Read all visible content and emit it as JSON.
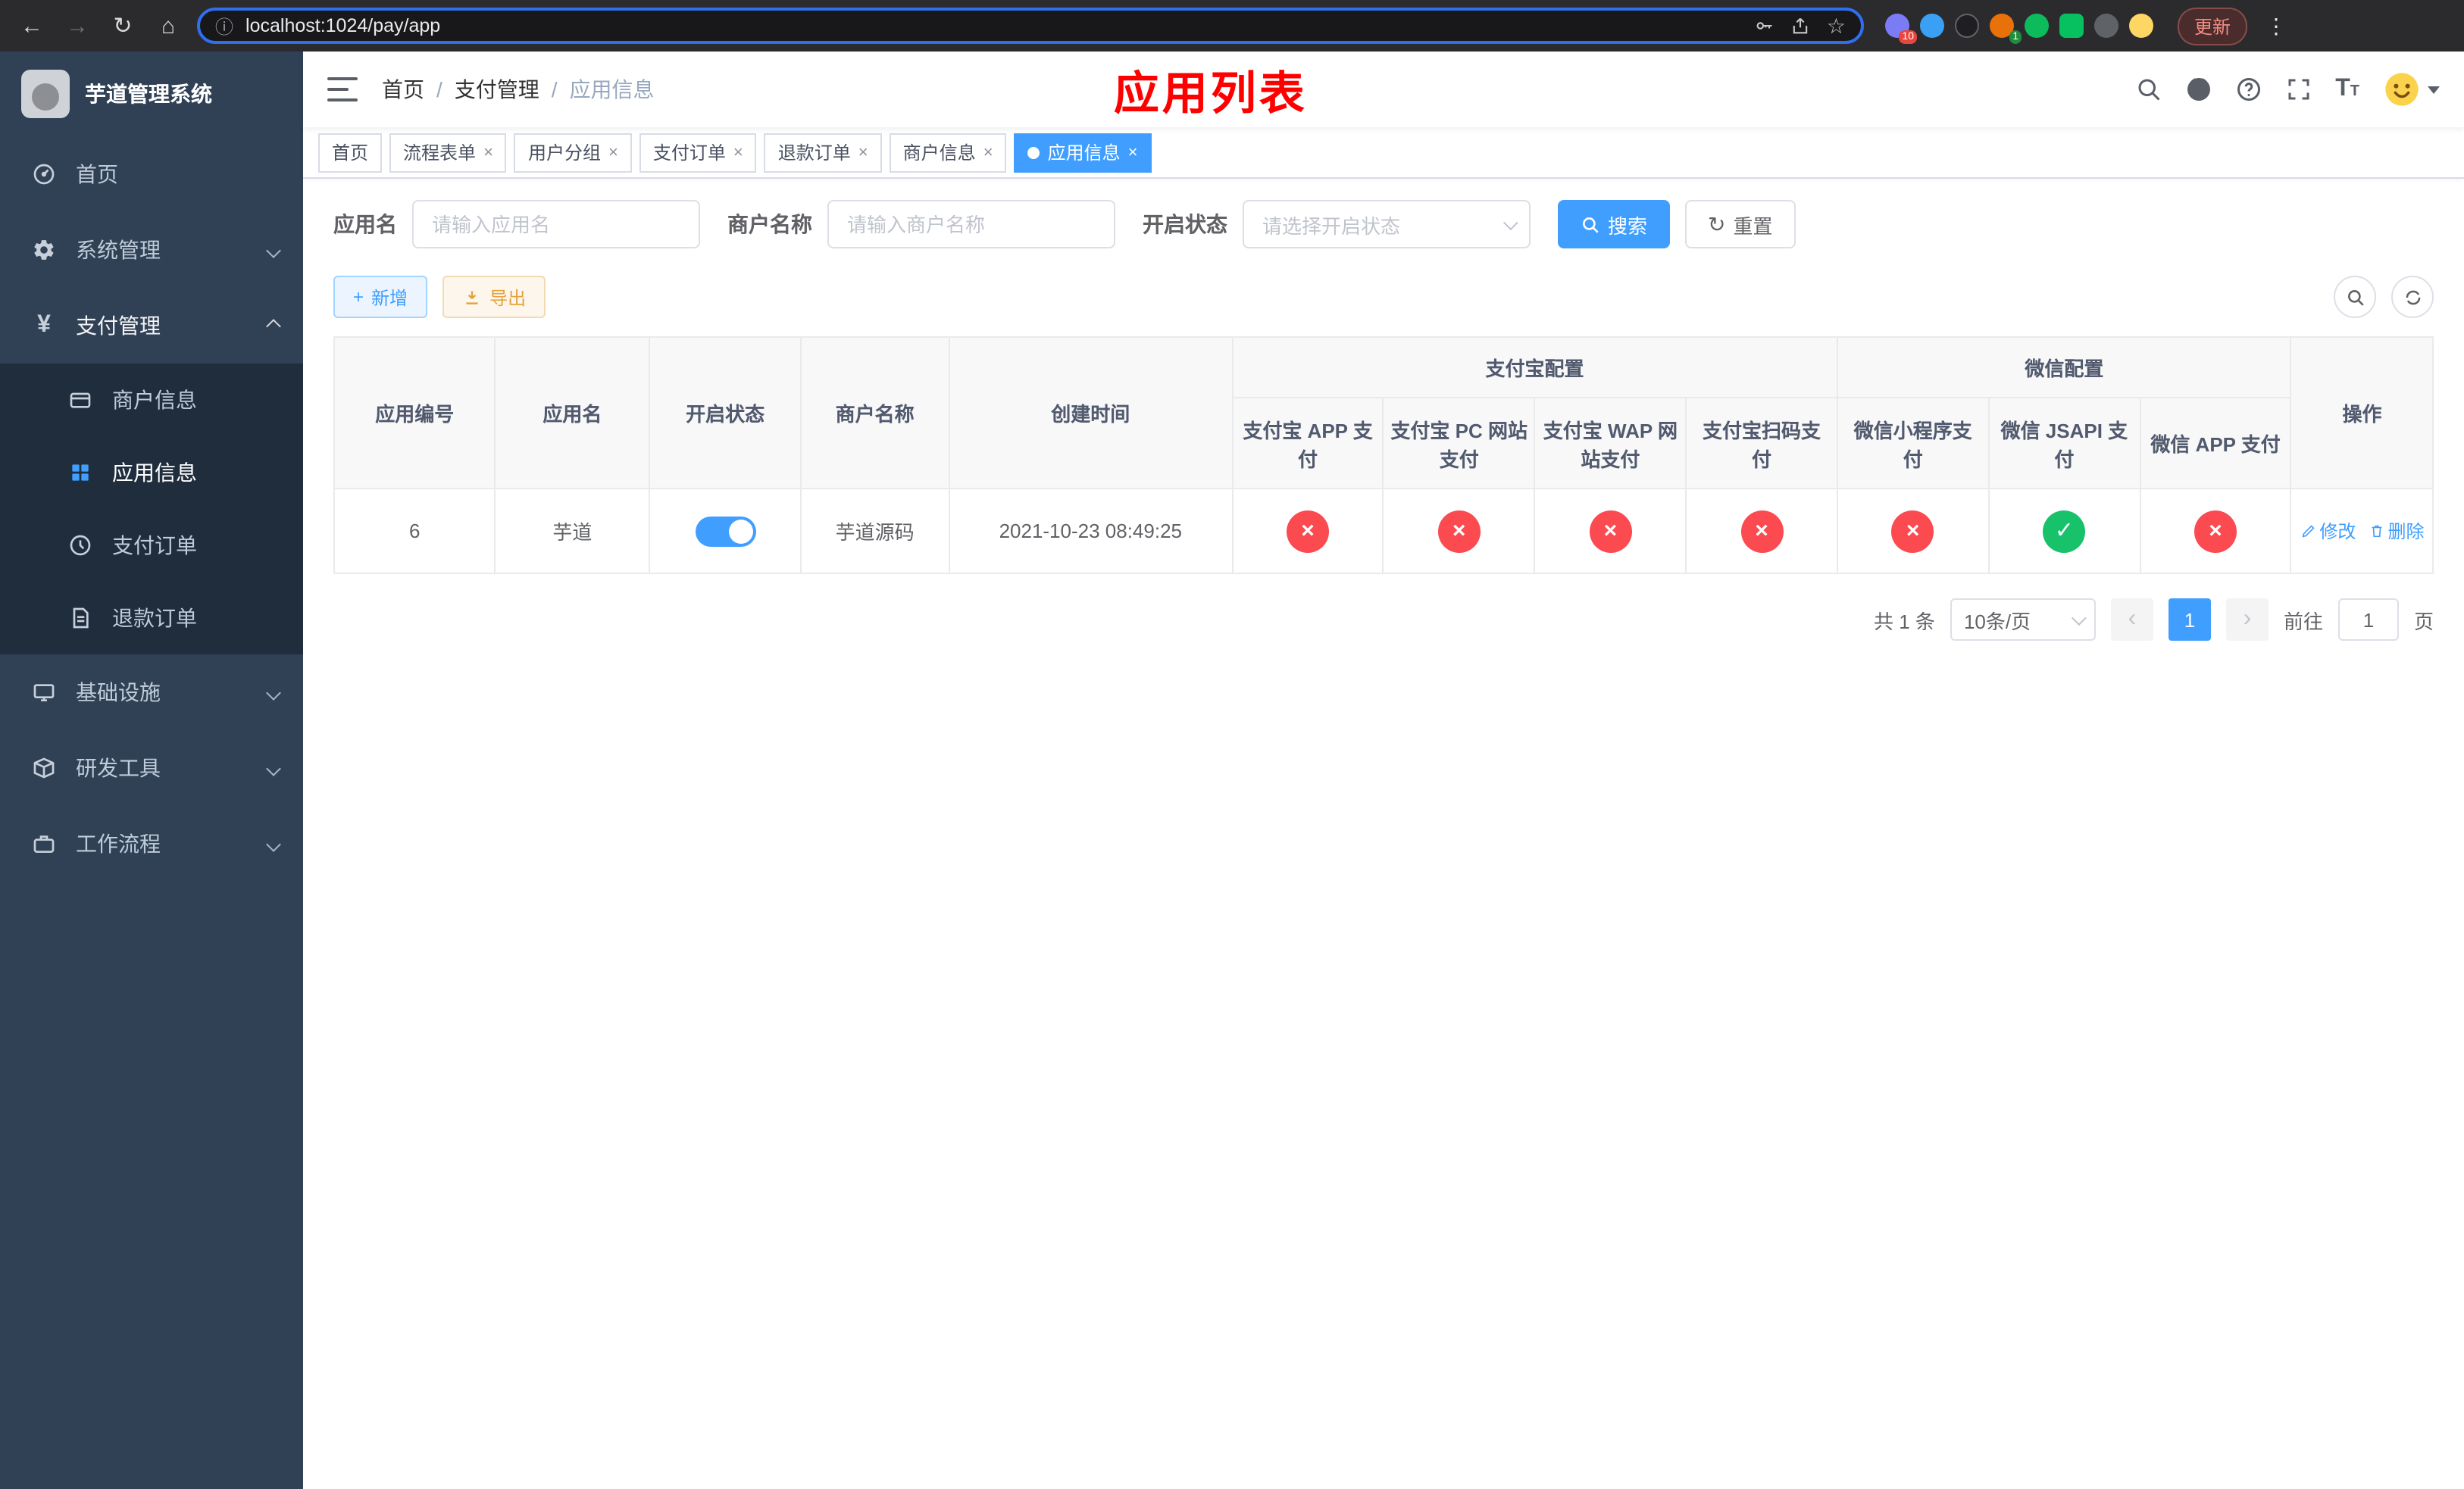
{
  "colors": {
    "accent": "#409eff",
    "status_yes": "#17c26b",
    "status_no": "#fb4a50",
    "annotation": "#ff0000",
    "sidebar_bg": "#304156",
    "submenu_bg": "#1f2d3d"
  },
  "browser": {
    "url": "localhost:1024/pay/app",
    "update_label": "更新",
    "ext_badge_red": "10",
    "ext_badge_green": "1"
  },
  "sidebar": {
    "title": "芋道管理系统",
    "items": [
      {
        "label": "首页"
      },
      {
        "label": "系统管理"
      },
      {
        "label": "支付管理",
        "children": [
          {
            "label": "商户信息"
          },
          {
            "label": "应用信息"
          },
          {
            "label": "支付订单"
          },
          {
            "label": "退款订单"
          }
        ]
      },
      {
        "label": "基础设施"
      },
      {
        "label": "研发工具"
      },
      {
        "label": "工作流程"
      }
    ]
  },
  "header": {
    "breadcrumb": [
      "首页",
      "支付管理",
      "应用信息"
    ],
    "separator": "/",
    "annotation": "应用列表"
  },
  "tabs": [
    {
      "label": "首页"
    },
    {
      "label": "流程表单"
    },
    {
      "label": "用户分组"
    },
    {
      "label": "支付订单"
    },
    {
      "label": "退款订单"
    },
    {
      "label": "商户信息"
    },
    {
      "label": "应用信息"
    }
  ],
  "filters": {
    "app_name_label": "应用名",
    "app_name_placeholder": "请输入应用名",
    "merchant_label": "商户名称",
    "merchant_placeholder": "请输入商户名称",
    "status_label": "开启状态",
    "status_placeholder": "请选择开启状态",
    "search_label": "搜索",
    "reset_label": "重置"
  },
  "toolbar": {
    "add_label": "新增",
    "export_label": "导出"
  },
  "table": {
    "headers": {
      "id": "应用编号",
      "name": "应用名",
      "status": "开启状态",
      "merchant": "商户名称",
      "created": "创建时间",
      "alipay_group": "支付宝配置",
      "wechat_group": "微信配置",
      "op": "操作"
    },
    "sub_headers": [
      "支付宝 APP 支付",
      "支付宝 PC 网站支付",
      "支付宝 WAP 网站支付",
      "支付宝扫码支付",
      "微信小程序支付",
      "微信 JSAPI 支付",
      "微信 APP 支付"
    ],
    "rows": [
      {
        "id": "6",
        "name": "芋道",
        "enabled": true,
        "merchant": "芋道源码",
        "created": "2021-10-23 08:49:25",
        "statuses": [
          false,
          false,
          false,
          false,
          false,
          true,
          false
        ],
        "edit_label": "修改",
        "delete_label": "删除"
      }
    ]
  },
  "pagination": {
    "total": "共 1 条",
    "page_size": "10条/页",
    "page": "1",
    "goto_label": "前往",
    "goto_value": "1",
    "unit_label": "页"
  }
}
